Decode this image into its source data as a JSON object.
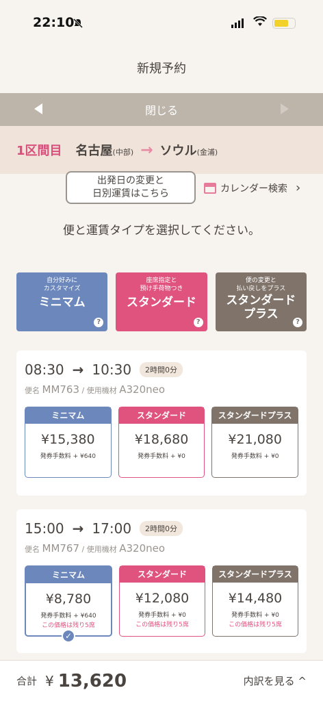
{
  "status": {
    "time": "22:10"
  },
  "header": {
    "title": "新規予約"
  },
  "nav": {
    "close_label": "閉じる"
  },
  "segment": {
    "label": "1区間目",
    "origin": "名古屋",
    "origin_sub": "(中部)",
    "destination": "ソウル",
    "destination_sub": "(金浦)"
  },
  "tooltip": {
    "line1": "出発日の変更と",
    "line2": "日別運賃はこちら"
  },
  "calendar": {
    "label": "カレンダー検索",
    "chevron": "›"
  },
  "instruction": "便と運賃タイプを選択してください。",
  "fare_types": [
    {
      "desc_line1": "自分好みに",
      "desc_line2": "カスタマイズ",
      "name_line1": "ミニマム",
      "name_line2": "",
      "help": "?"
    },
    {
      "desc_line1": "座席指定と",
      "desc_line2": "預け手荷物つき",
      "name_line1": "スタンダード",
      "name_line2": "",
      "help": "?"
    },
    {
      "desc_line1": "便の変更と",
      "desc_line2": "払い戻しをプラス",
      "name_line1": "スタンダード",
      "name_line2": "プラス",
      "help": "?"
    }
  ],
  "flights": [
    {
      "depart": "08:30",
      "arrive": "10:30",
      "duration": "2時間0分",
      "flight_label": "便名",
      "flight_no": "MM763",
      "aircraft_label": "/ 使用機材",
      "aircraft": "A320neo",
      "fares": [
        {
          "name": "ミニマム",
          "price": "¥15,380",
          "fee": "発券手数料 + ¥640",
          "remain": ""
        },
        {
          "name": "スタンダード",
          "price": "¥18,680",
          "fee": "発券手数料 + ¥0",
          "remain": ""
        },
        {
          "name": "スタンダードプラス",
          "price": "¥21,080",
          "fee": "発券手数料 + ¥0",
          "remain": ""
        }
      ]
    },
    {
      "depart": "15:00",
      "arrive": "17:00",
      "duration": "2時間0分",
      "flight_label": "便名",
      "flight_no": "MM767",
      "aircraft_label": "/ 使用機材",
      "aircraft": "A320neo",
      "fares": [
        {
          "name": "ミニマム",
          "price": "¥8,780",
          "fee": "発券手数料 + ¥640",
          "remain": "この価格は残り5席"
        },
        {
          "name": "スタンダード",
          "price": "¥12,080",
          "fee": "発券手数料 + ¥0",
          "remain": "この価格は残り5席"
        },
        {
          "name": "スタンダードプラス",
          "price": "¥14,480",
          "fee": "発券手数料 + ¥0",
          "remain": "この価格は残り5席"
        }
      ]
    }
  ],
  "total": {
    "label": "合計",
    "yen": "¥",
    "amount": "13,620",
    "breakdown": "内訳を見る ^"
  }
}
